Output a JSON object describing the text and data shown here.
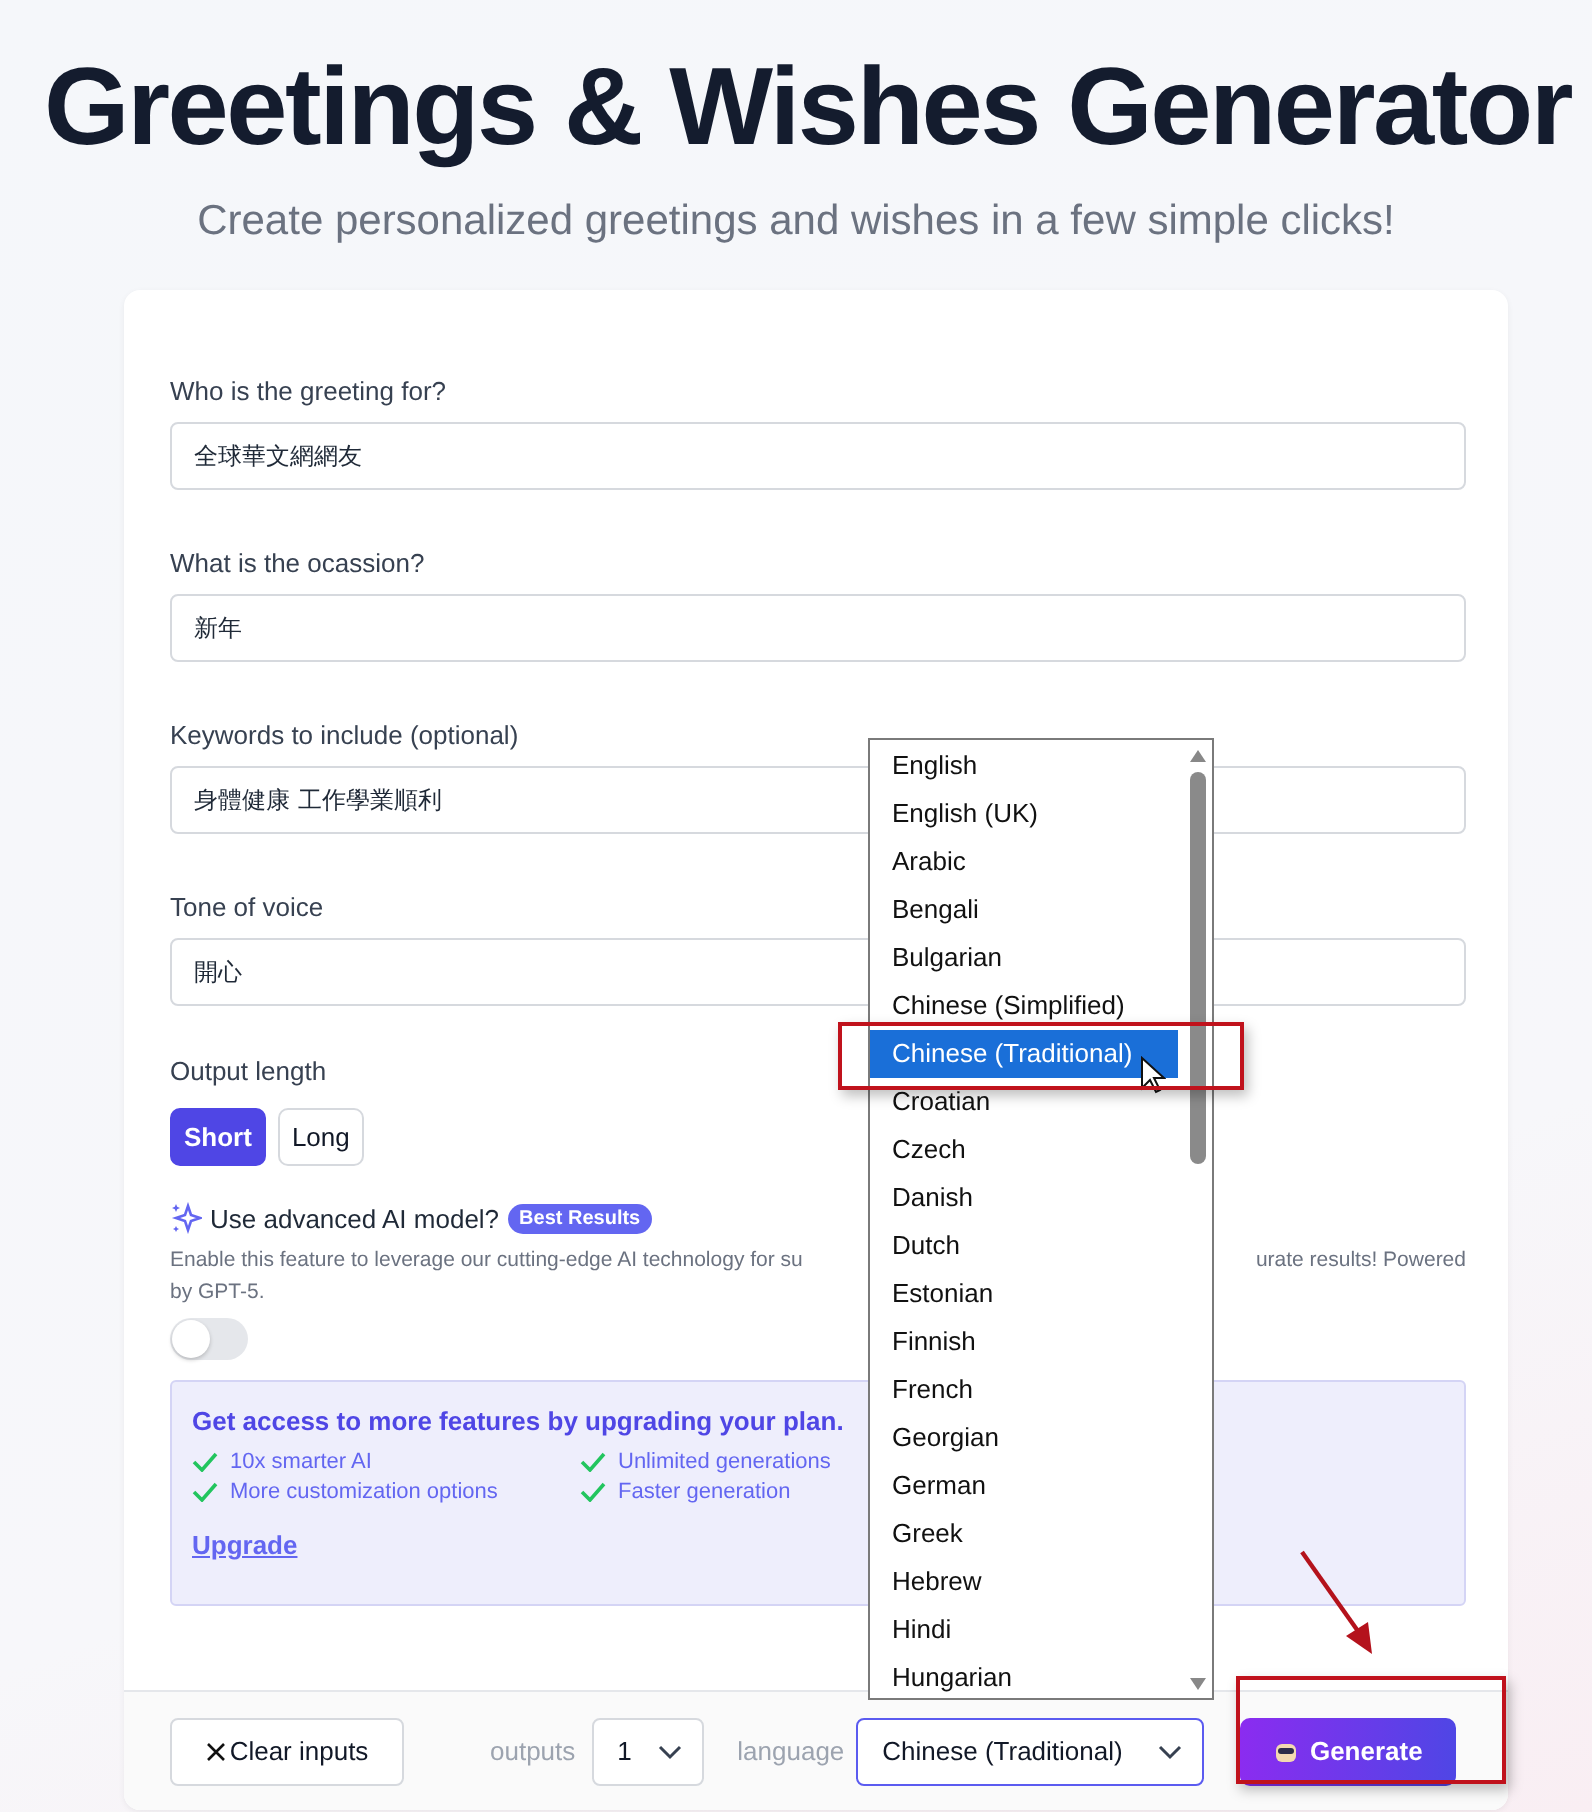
{
  "header": {
    "title": "Greetings & Wishes Generator",
    "subtitle": "Create personalized greetings and wishes in a few simple clicks!"
  },
  "fields": [
    {
      "label": "Who is the greeting for?",
      "value": "全球華文網網友"
    },
    {
      "label": "What is the ocassion?",
      "value": "新年"
    },
    {
      "label": "Keywords to include (optional)",
      "value": "身體健康  工作學業順利"
    },
    {
      "label": "Tone of voice",
      "value": "開心"
    }
  ],
  "output_length": {
    "label": "Output length",
    "options": [
      {
        "label": "Short",
        "selected": true
      },
      {
        "label": "Long",
        "selected": false
      }
    ]
  },
  "advanced": {
    "label": "Use advanced AI model?",
    "badge": "Best Results",
    "description_left": "Enable this feature to leverage our cutting-edge AI technology for su",
    "description_right": "urate results! Powered",
    "description_line2": "by GPT-5.",
    "on": false
  },
  "upgrade": {
    "title": "Get access to more features by upgrading your plan.",
    "features": [
      "10x smarter AI",
      "Unlimited generations",
      "More customization options",
      "Faster generation"
    ],
    "link": "Upgrade"
  },
  "footer": {
    "clear": "Clear inputs",
    "outputs_label": "outputs",
    "outputs_value": "1",
    "language_label": "language",
    "language_value": "Chinese (Traditional)",
    "generate": "Generate"
  },
  "language_list": [
    {
      "label": "English",
      "selected": false
    },
    {
      "label": "English (UK)",
      "selected": false
    },
    {
      "label": "Arabic",
      "selected": false
    },
    {
      "label": "Bengali",
      "selected": false
    },
    {
      "label": "Bulgarian",
      "selected": false
    },
    {
      "label": "Chinese (Simplified)",
      "selected": false
    },
    {
      "label": "Chinese (Traditional)",
      "selected": true
    },
    {
      "label": "Croatian",
      "selected": false
    },
    {
      "label": "Czech",
      "selected": false
    },
    {
      "label": "Danish",
      "selected": false
    },
    {
      "label": "Dutch",
      "selected": false
    },
    {
      "label": "Estonian",
      "selected": false
    },
    {
      "label": "Finnish",
      "selected": false
    },
    {
      "label": "French",
      "selected": false
    },
    {
      "label": "Georgian",
      "selected": false
    },
    {
      "label": "German",
      "selected": false
    },
    {
      "label": "Greek",
      "selected": false
    },
    {
      "label": "Hebrew",
      "selected": false
    },
    {
      "label": "Hindi",
      "selected": false
    },
    {
      "label": "Hungarian",
      "selected": false
    }
  ]
}
